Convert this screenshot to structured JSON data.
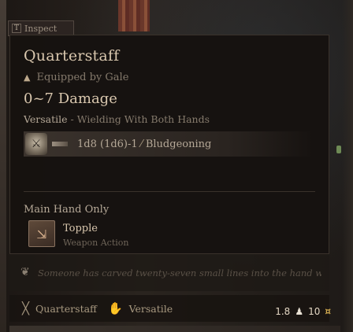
{
  "inspect": {
    "key": "T",
    "label": "Inspect"
  },
  "item": {
    "name": "Quarterstaff",
    "equipped": "Equipped by Gale",
    "damage": "0~7 Damage",
    "versatile_kw": "Versatile",
    "versatile_desc": " - Wielding With Both Hands",
    "damage_roll": "1d8 (1d6)-1",
    "damage_type": "Bludgeoning",
    "hand": "Main Hand Only",
    "action_name": "Topple",
    "action_sub": "Weapon Action",
    "flavor": "Someone has carved twenty-seven small lines into the hand wood.",
    "prop1_label": "Quarterstaff",
    "prop2_label": "Versatile",
    "weight": "1.8",
    "value": "10"
  },
  "icons": {
    "equipped": "triangle-icon",
    "damage": "staff-icon",
    "damage_type": "slash-icon",
    "action": "topple-icon",
    "flavor": "feather-icon",
    "prop1": "quarterstaff-icon",
    "prop2": "versatile-icon",
    "weight": "weight-icon",
    "coin": "coin-icon"
  },
  "colors": {
    "accent": "#d9c7ae",
    "muted": "#857a6c",
    "coin": "#d6ae52"
  }
}
